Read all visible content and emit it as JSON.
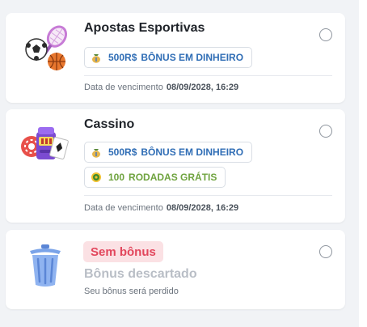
{
  "bonuses": [
    {
      "title": "Apostas Esportivas",
      "icon": "sports-balls-icon",
      "chips": [
        {
          "kind": "money",
          "icon": "money-bag-icon",
          "amount": "500R$",
          "label": "BÔNUS EM DINHEIRO"
        }
      ],
      "expiry_label": "Data de vencimento",
      "expiry_value": "08/09/2028, 16:29",
      "selected": false
    },
    {
      "title": "Cassino",
      "icon": "casino-slot-icon",
      "chips": [
        {
          "kind": "money",
          "icon": "money-bag-icon",
          "amount": "500R$",
          "label": "BÔNUS EM DINHEIRO"
        },
        {
          "kind": "spins",
          "icon": "spin-coin-icon",
          "amount": "100",
          "label": "RODADAS GRÁTIS"
        }
      ],
      "expiry_label": "Data de vencimento",
      "expiry_value": "08/09/2028, 16:29",
      "selected": false
    }
  ],
  "no_bonus": {
    "badge": "Sem bônus",
    "title": "Bônus descartado",
    "subtitle": "Seu bônus será perdido",
    "icon": "trash-can-icon",
    "selected": false
  },
  "colors": {
    "money_text": "#2f6db5",
    "spins_text": "#6fa33f",
    "badge_bg": "#fbe1e4",
    "badge_text": "#e2465c",
    "panel_bg": "#f1f3f6"
  }
}
